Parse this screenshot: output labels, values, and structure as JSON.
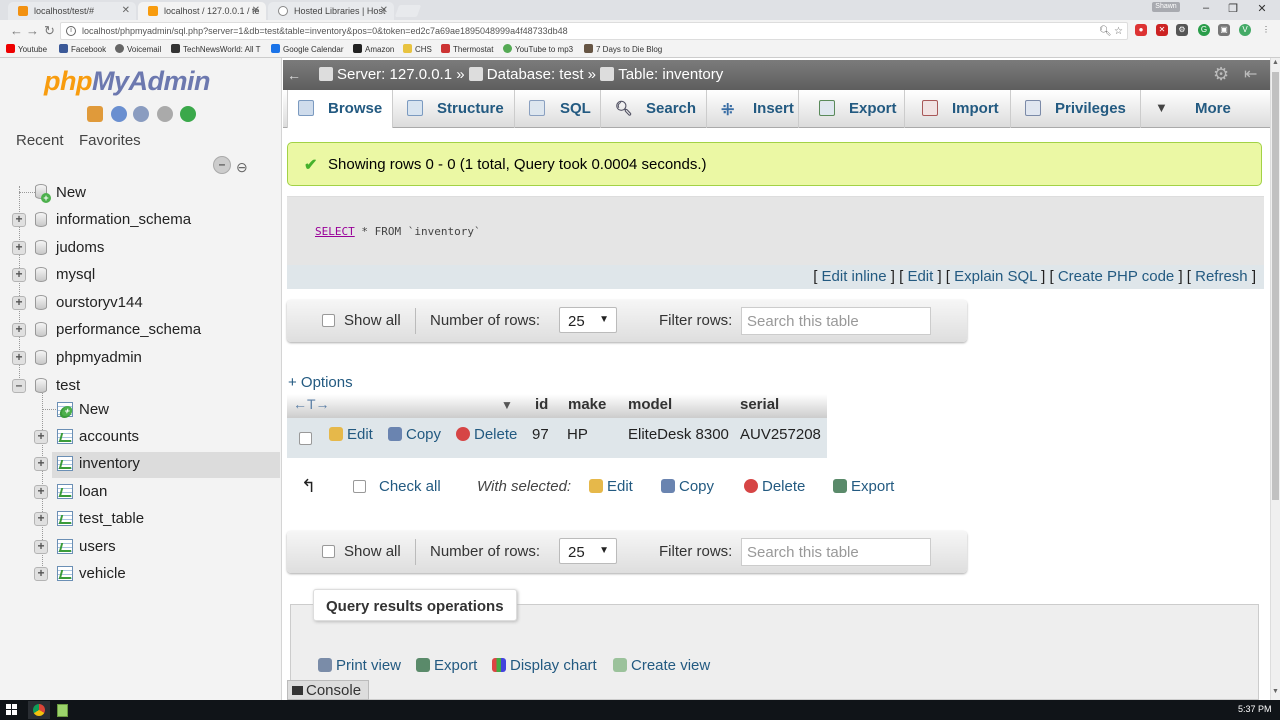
{
  "browser": {
    "tabs": [
      {
        "label": "localhost/test/#"
      },
      {
        "label": "localhost / 127.0.0.1 / te"
      },
      {
        "label": "Hosted Libraries | Host"
      }
    ],
    "user_chip": "Shawn",
    "url": "localhost/phpmyadmin/sql.php?server=1&db=test&table=inventory&pos=0&token=ed2c7a69ae1895048999a4f48733db48",
    "bookmarks": [
      "Youtube",
      "Facebook",
      "Voicemail",
      "TechNewsWorld: All T",
      "Google Calendar",
      "Amazon",
      "CHS",
      "Thermostat",
      "YouTube to mp3",
      "7 Days to Die Blog"
    ],
    "colors": {
      "accent": "#235a81",
      "logo_blue": "#6c78af",
      "logo_orange": "#f89c0e"
    }
  },
  "sidebar": {
    "logo_php": "php",
    "logo_myadmin": "MyAdmin",
    "recent": "Recent",
    "favorites": "Favorites",
    "tree": [
      {
        "label": "New"
      },
      {
        "label": "information_schema"
      },
      {
        "label": "judoms"
      },
      {
        "label": "mysql"
      },
      {
        "label": "ourstoryv144"
      },
      {
        "label": "performance_schema"
      },
      {
        "label": "phpmyadmin"
      },
      {
        "label": "test"
      }
    ],
    "test_children": [
      {
        "label": "New"
      },
      {
        "label": "accounts"
      },
      {
        "label": "inventory"
      },
      {
        "label": "loan"
      },
      {
        "label": "test_table"
      },
      {
        "label": "users"
      },
      {
        "label": "vehicle"
      }
    ]
  },
  "breadcrumb": {
    "server": "Server: 127.0.0.1",
    "sep1": "»",
    "database": "Database: test",
    "sep2": "»",
    "table": "Table: inventory"
  },
  "tabs": [
    {
      "label": "Browse"
    },
    {
      "label": "Structure"
    },
    {
      "label": "SQL"
    },
    {
      "label": "Search"
    },
    {
      "label": "Insert"
    },
    {
      "label": "Export"
    },
    {
      "label": "Import"
    },
    {
      "label": "Privileges"
    },
    {
      "label": "More"
    }
  ],
  "success_message": "Showing rows 0 - 0 (1 total, Query took 0.0004 seconds.)",
  "sql": {
    "keyword": "SELECT",
    "rest": " * FROM `inventory`",
    "links": {
      "edit_inline": "Edit inline",
      "edit": "Edit",
      "explain": "Explain SQL",
      "php": "Create PHP code",
      "refresh": "Refresh"
    }
  },
  "navform": {
    "show_all": "Show all",
    "number_of_rows": "Number of rows:",
    "rows_value": "25",
    "filter_rows": "Filter rows:",
    "search_placeholder": "Search this table"
  },
  "options_link": "+ Options",
  "results": {
    "columns": [
      "id",
      "make",
      "model",
      "serial"
    ],
    "row": {
      "edit": "Edit",
      "copy": "Copy",
      "delete": "Delete",
      "id": "97",
      "make": "HP",
      "model": "EliteDesk 8300",
      "serial": "AUV257208"
    }
  },
  "bulk": {
    "check_all": "Check all",
    "with_selected": "With selected:",
    "edit": "Edit",
    "copy": "Copy",
    "delete": "Delete",
    "export": "Export"
  },
  "query_ops": {
    "legend": "Query results operations",
    "print_view": "Print view",
    "export": "Export",
    "display_chart": "Display chart",
    "create_view": "Create view"
  },
  "console": "Console",
  "taskbar": {
    "clock": "5:37 PM"
  }
}
